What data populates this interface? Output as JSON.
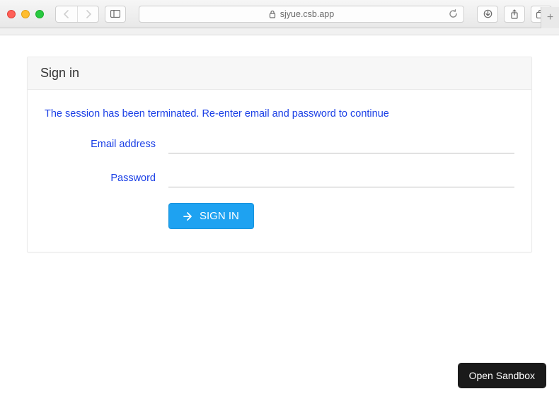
{
  "browser": {
    "url_display": "sjyue.csb.app"
  },
  "page": {
    "card_title": "Sign in",
    "message": "The session has been terminated. Re-enter email and password to continue",
    "labels": {
      "email": "Email address",
      "password": "Password"
    },
    "fields": {
      "email": "",
      "password": ""
    },
    "signin_button": "SIGN IN"
  },
  "floating": {
    "open_sandbox": "Open Sandbox"
  }
}
